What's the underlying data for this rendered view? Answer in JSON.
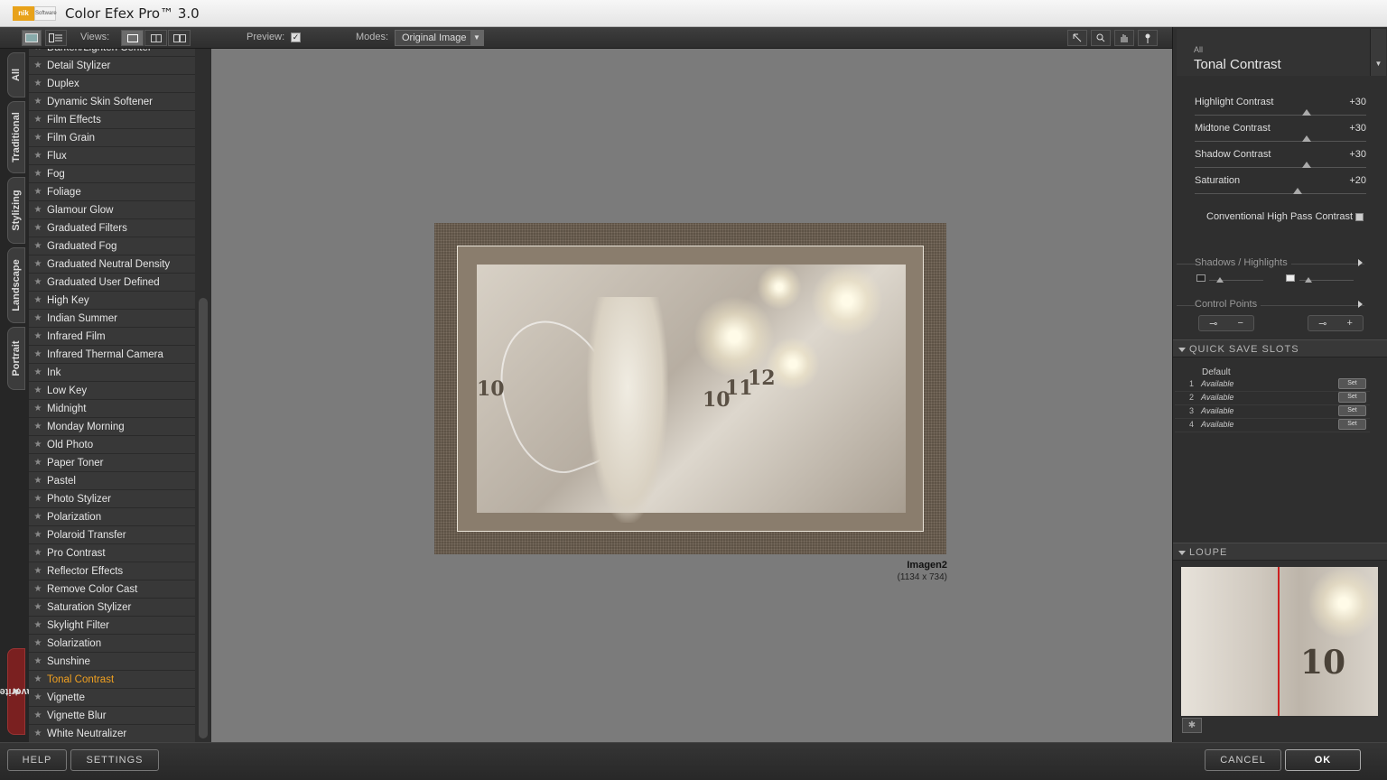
{
  "window": {
    "title": "Color Efex Pro™ 3.0",
    "logo_primary": "nik",
    "logo_secondary": "Software"
  },
  "toolbar": {
    "views_label": "Views:",
    "preview_label": "Preview:",
    "preview_checked": "✓",
    "modes_label": "Modes:",
    "modes_value": "Original Image",
    "tools": [
      "pointer-icon",
      "zoom-icon",
      "hand-icon",
      "control-point-icon"
    ]
  },
  "tabs": [
    {
      "label": "All"
    },
    {
      "label": "Traditional"
    },
    {
      "label": "Stylizing"
    },
    {
      "label": "Landscape"
    },
    {
      "label": "Portrait"
    },
    {
      "label": "Favorites"
    }
  ],
  "filters": [
    "Darken/Lighten Center",
    "Detail Stylizer",
    "Duplex",
    "Dynamic Skin Softener",
    "Film Effects",
    "Film Grain",
    "Flux",
    "Fog",
    "Foliage",
    "Glamour Glow",
    "Graduated Filters",
    "Graduated Fog",
    "Graduated Neutral Density",
    "Graduated User Defined",
    "High Key",
    "Indian Summer",
    "Infrared Film",
    "Infrared Thermal Camera",
    "Ink",
    "Low Key",
    "Midnight",
    "Monday Morning",
    "Old Photo",
    "Paper Toner",
    "Pastel",
    "Photo Stylizer",
    "Polarization",
    "Polaroid Transfer",
    "Pro Contrast",
    "Reflector Effects",
    "Remove Color Cast",
    "Saturation Stylizer",
    "Skylight Filter",
    "Solarization",
    "Sunshine",
    "Tonal Contrast",
    "Vignette",
    "Vignette Blur",
    "White Neutralizer"
  ],
  "active_filter": "Tonal Contrast",
  "image": {
    "name": "Imagen2",
    "dimensions": "(1134 x 734)",
    "clock_numbers": [
      "10",
      "10",
      "11",
      "12"
    ]
  },
  "panel": {
    "category": "All",
    "filter_name": "Tonal Contrast",
    "sliders": [
      {
        "label": "Highlight Contrast",
        "value": "+30",
        "fraction": 0.65
      },
      {
        "label": "Midtone Contrast",
        "value": "+30",
        "fraction": 0.65
      },
      {
        "label": "Shadow Contrast",
        "value": "+30",
        "fraction": 0.65
      },
      {
        "label": "Saturation",
        "value": "+20",
        "fraction": 0.6
      }
    ],
    "high_pass_label": "Conventional High Pass Contrast",
    "shadows_highlights_label": "Shadows / Highlights",
    "control_points_label": "Control Points",
    "quick_save_label": "QUICK SAVE SLOTS",
    "default_label": "Default",
    "slots": [
      {
        "num": "1",
        "name": "Available",
        "set": "Set"
      },
      {
        "num": "2",
        "name": "Available",
        "set": "Set"
      },
      {
        "num": "3",
        "name": "Available",
        "set": "Set"
      },
      {
        "num": "4",
        "name": "Available",
        "set": "Set"
      }
    ],
    "loupe_label": "LOUPE",
    "loupe_number": "10"
  },
  "buttons": {
    "help": "HELP",
    "settings": "SETTINGS",
    "cancel": "CANCEL",
    "ok": "OK"
  },
  "colors": {
    "accent": "#f0a020",
    "favorites_tab": "#7a2020",
    "loupe_split": "#cc2020"
  }
}
